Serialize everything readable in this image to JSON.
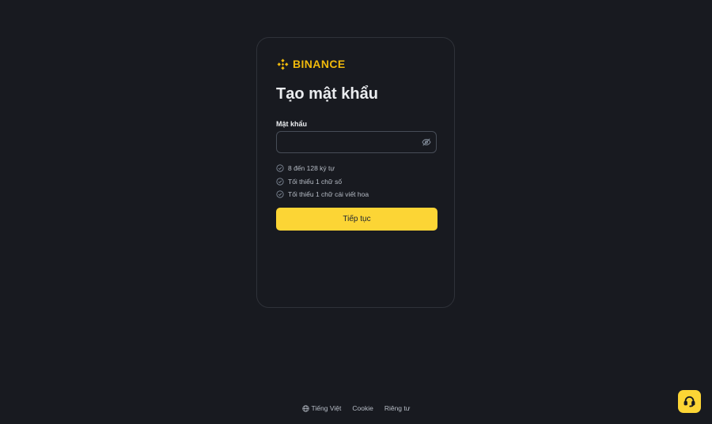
{
  "brand": {
    "name": "BINANCE",
    "color": "#f0b90b"
  },
  "form": {
    "title": "Tạo mật khẩu",
    "password_label": "Mật khẩu",
    "password_value": "",
    "password_placeholder": "",
    "toggle_icon": "eye-off-icon",
    "rules": [
      {
        "text": "8 đến 128 ký tự",
        "icon": "check-circle-icon"
      },
      {
        "text": "Tối thiểu 1 chữ số",
        "icon": "check-circle-icon"
      },
      {
        "text": "Tối thiểu 1 chữ cái viết hoa",
        "icon": "check-circle-icon"
      }
    ],
    "submit_label": "Tiếp tục"
  },
  "footer": {
    "language_icon": "globe-icon",
    "language": "Tiếng Việt",
    "cookie": "Cookie",
    "privacy": "Riêng tư"
  },
  "support": {
    "icon": "headset-icon"
  },
  "colors": {
    "background": "#181a20",
    "accent": "#fcd535",
    "border": "#2f3239",
    "muted_text": "#b7bdc6"
  }
}
